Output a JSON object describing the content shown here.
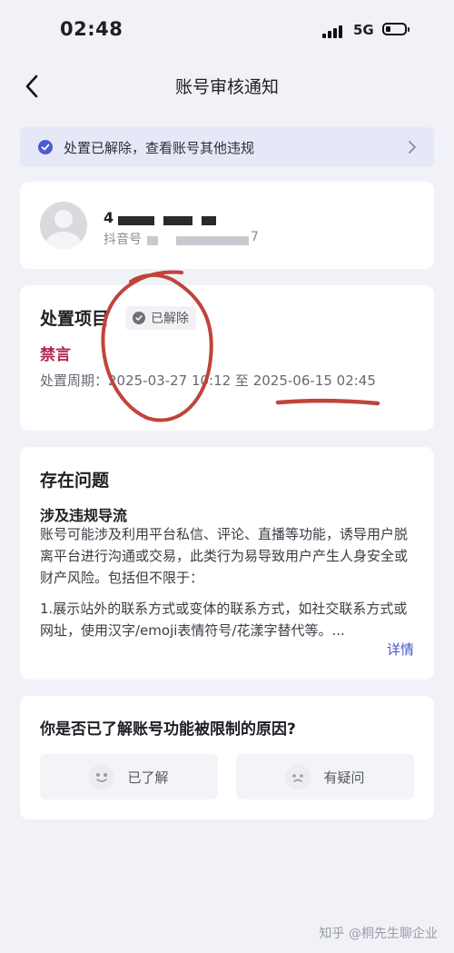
{
  "status_bar": {
    "time": "02:48",
    "network": "5G"
  },
  "nav": {
    "title": "账号审核通知"
  },
  "notice": {
    "text": "处置已解除，查看账号其他违规"
  },
  "user": {
    "name": "4",
    "id_prefix": "抖音号",
    "id_suffix": "7"
  },
  "disposal": {
    "title": "处置项目",
    "badge": "已解除",
    "penalty": "禁言",
    "period": "处置周期：2025-03-27 10:12 至 2025-06-15 02:45"
  },
  "problem": {
    "title": "存在问题",
    "subtitle": "涉及违规导流",
    "body": "账号可能涉及利用平台私信、评论、直播等功能，诱导用户脱离平台进行沟通或交易，此类行为易导致用户产生人身安全或财产风险。包括但不限于：",
    "example": "1.展示站外的联系方式或变体的联系方式，如社交联系方式或网址，使用汉字/emoji表情符号/花漾字替代等。...",
    "details_label": "详情"
  },
  "feedback": {
    "question": "你是否已了解账号功能被限制的原因?",
    "understood_label": "已了解",
    "doubt_label": "有疑问"
  },
  "watermark": "知乎 @桐先生聊企业",
  "colors": {
    "accent": "#4c5bd4",
    "penalty": "#b0264c",
    "annotation": "#c0443a"
  },
  "icons": [
    "back-arrow-icon",
    "check-circle-icon",
    "chevron-right-icon",
    "avatar-placeholder-icon",
    "smile-icon",
    "confused-icon"
  ]
}
